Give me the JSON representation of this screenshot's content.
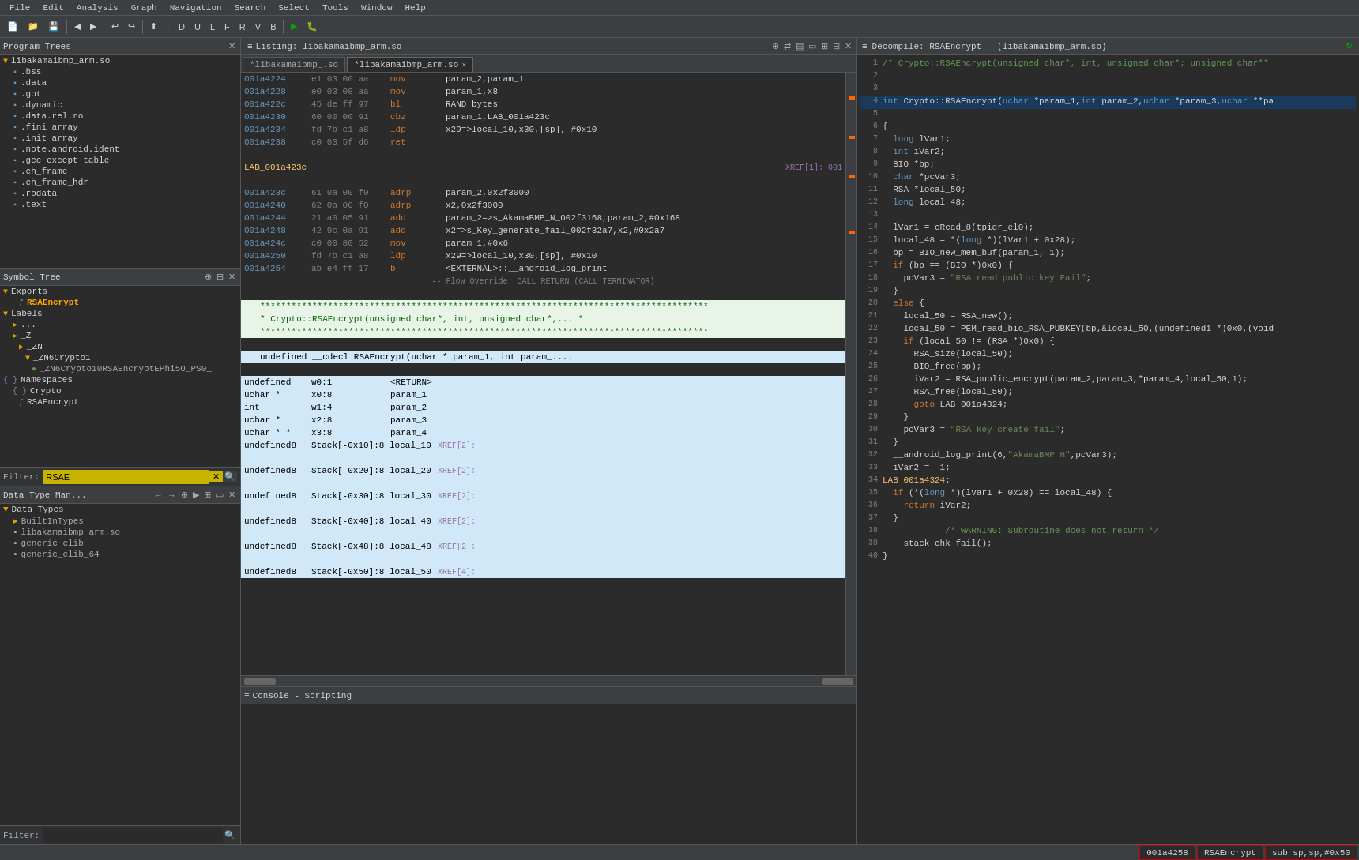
{
  "menubar": {
    "items": [
      "File",
      "Edit",
      "Analysis",
      "Graph",
      "Navigation",
      "Search",
      "Select",
      "Tools",
      "Window",
      "Help"
    ]
  },
  "left_panel": {
    "program_trees": {
      "title": "Program Trees",
      "items": [
        {
          "label": "libakamaibmp_arm.so",
          "type": "root",
          "indent": 0
        },
        {
          "label": ".bss",
          "type": "file",
          "indent": 1
        },
        {
          "label": ".data",
          "type": "file",
          "indent": 1
        },
        {
          "label": ".got",
          "type": "file",
          "indent": 1
        },
        {
          "label": ".dynamic",
          "type": "file",
          "indent": 1
        },
        {
          "label": ".data.rel.ro",
          "type": "file",
          "indent": 1
        },
        {
          "label": ".fini_array",
          "type": "file",
          "indent": 1
        },
        {
          "label": ".init_array",
          "type": "file",
          "indent": 1
        },
        {
          "label": ".note.android.ident",
          "type": "file",
          "indent": 1
        },
        {
          "label": ".gcc_except_table",
          "type": "file",
          "indent": 1
        },
        {
          "label": ".eh_frame",
          "type": "file",
          "indent": 1
        },
        {
          "label": ".eh_frame_hdr",
          "type": "file",
          "indent": 1
        },
        {
          "label": ".rodata",
          "type": "file",
          "indent": 1
        },
        {
          "label": ".text",
          "type": "file",
          "indent": 1
        },
        {
          "label": "...",
          "type": "file",
          "indent": 1
        }
      ]
    },
    "symbol_tree": {
      "title": "Symbol Tree",
      "items": [
        {
          "label": "Exports",
          "type": "folder",
          "indent": 0,
          "expanded": true
        },
        {
          "label": "RSAEncrypt",
          "type": "func",
          "indent": 2,
          "selected": true
        },
        {
          "label": "Labels",
          "type": "folder",
          "indent": 0,
          "expanded": true
        },
        {
          "label": "...",
          "type": "folder",
          "indent": 1
        },
        {
          "label": "_Z",
          "type": "folder",
          "indent": 1
        },
        {
          "label": "_ZN",
          "type": "folder",
          "indent": 2
        },
        {
          "label": "_ZN6Crypto1",
          "type": "folder",
          "indent": 3
        },
        {
          "label": "_ZN6Crypto10RSAEncryptEPhi50_PS0_",
          "type": "func",
          "indent": 4
        },
        {
          "label": "Namespaces",
          "type": "folder",
          "indent": 0
        },
        {
          "label": "Crypto",
          "type": "namespace",
          "indent": 1
        },
        {
          "label": "RSAEncrypt",
          "type": "func",
          "indent": 2
        }
      ]
    },
    "filter": {
      "label": "Filter:",
      "value": "RSAE"
    },
    "data_type_manager": {
      "title": "Data Type Man...",
      "items": [
        {
          "label": "Data Types",
          "type": "folder",
          "indent": 0
        },
        {
          "label": "BuiltInTypes",
          "type": "folder",
          "indent": 1
        },
        {
          "label": "libakamaibmp_arm.so",
          "type": "file",
          "indent": 1
        },
        {
          "label": "generic_clib",
          "type": "folder",
          "indent": 1
        },
        {
          "label": "generic_clib_64",
          "type": "folder",
          "indent": 1
        }
      ]
    },
    "filter_bottom": {
      "label": "Filter:",
      "placeholder": ""
    }
  },
  "center_panel": {
    "listing_header": {
      "title": "Listing: libakamaibmp_arm.so"
    },
    "tabs": [
      {
        "label": "*libakamaibmp_.so",
        "active": false
      },
      {
        "label": "*libakamaibmp_arm.so",
        "active": true
      }
    ],
    "code_lines": [
      {
        "addr": "001a4224",
        "bytes": "e1 03 00 aa",
        "mnemonic": "mov",
        "operands": "param_2,param_1",
        "type": "normal"
      },
      {
        "addr": "001a4228",
        "bytes": "e0 03 08 aa",
        "mnemonic": "mov",
        "operands": "param_1,x8",
        "type": "normal"
      },
      {
        "addr": "001a422c",
        "bytes": "45 de ff 97",
        "mnemonic": "bl",
        "operands": "RAND_bytes",
        "type": "normal"
      },
      {
        "addr": "001a4230",
        "bytes": "60 00 00 91",
        "mnemonic": "cbz",
        "operands": "param_1,LAB_001a423c",
        "type": "normal"
      },
      {
        "addr": "001a4234",
        "bytes": "fd 7b c1 a8",
        "mnemonic": "ldp",
        "operands": "x29=>local_10,x30,[sp], #0x10",
        "type": "normal"
      },
      {
        "addr": "001a4238",
        "bytes": "c0 03 5f d6",
        "mnemonic": "ret",
        "operands": "",
        "type": "normal"
      },
      {
        "addr": "",
        "bytes": "",
        "mnemonic": "",
        "operands": "",
        "type": "spacer"
      },
      {
        "addr": "",
        "bytes": "LAB_001a423c",
        "mnemonic": "",
        "operands": "XREF[1]:  001",
        "type": "label"
      },
      {
        "addr": "",
        "bytes": "",
        "mnemonic": "",
        "operands": "",
        "type": "spacer"
      },
      {
        "addr": "001a423c",
        "bytes": "61 0a 00 f0",
        "mnemonic": "adrp",
        "operands": "param_2,0x2f3000",
        "type": "normal"
      },
      {
        "addr": "001a4240",
        "bytes": "62 0a 00 f0",
        "mnemonic": "adrp",
        "operands": "x2,0x2f3000",
        "type": "normal"
      },
      {
        "addr": "001a4244",
        "bytes": "21 a0 05 91",
        "mnemonic": "add",
        "operands": "param_2=>s_AkamaBMP_N_002f3168,param_2,#0x168",
        "type": "normal"
      },
      {
        "addr": "001a4248",
        "bytes": "42 9c 0a 91",
        "mnemonic": "add",
        "operands": "x2=>s_Key_generate_fail_002f32a7,x2,#0x2a7",
        "type": "normal"
      },
      {
        "addr": "001a424c",
        "bytes": "c0 00 80 52",
        "mnemonic": "mov",
        "operands": "param_1,#0x6",
        "type": "normal"
      },
      {
        "addr": "001a4250",
        "bytes": "fd 7b c1 a8",
        "mnemonic": "ldp",
        "operands": "x29=>local_10,x30,[sp], #0x10",
        "type": "normal"
      },
      {
        "addr": "001a4254",
        "bytes": "ab e4 ff 17",
        "mnemonic": "b",
        "operands": "<EXTERNAL>::__android_log_print",
        "type": "normal"
      },
      {
        "addr": "",
        "bytes": "-- Flow Override: CALL_RETURN (CALL_TERMINATOR)",
        "type": "flow-override"
      },
      {
        "addr": "",
        "bytes": "",
        "type": "spacer"
      },
      {
        "addr": "",
        "bytes": "* * * * * * * * * * * * * * * * * * * *",
        "type": "comment-stars"
      },
      {
        "addr": "",
        "bytes": "* Crypto::RSAEncrypt(unsigned char*, int, unsigned char*,... *",
        "type": "comment-text"
      },
      {
        "addr": "",
        "bytes": "* * * * * * * * * * * * * * * * * * * *",
        "type": "comment-stars"
      },
      {
        "addr": "",
        "bytes": "",
        "type": "spacer"
      },
      {
        "addr": "",
        "bytes": "undefined __cdecl RSAEncrypt(uchar * param_1, int param_....",
        "type": "func-sig"
      },
      {
        "addr": "",
        "bytes": "",
        "type": "spacer"
      },
      {
        "addr": "undefined",
        "bytes": "w0:1",
        "mnemonic": "<RETURN>",
        "operands": "",
        "type": "var-def"
      },
      {
        "addr": "uchar *",
        "bytes": "x0:8",
        "mnemonic": "param_1",
        "operands": "",
        "type": "var-def"
      },
      {
        "addr": "int",
        "bytes": "w1:4",
        "mnemonic": "param_2",
        "operands": "",
        "type": "var-def"
      },
      {
        "addr": "uchar *",
        "bytes": "x2:8",
        "mnemonic": "param_3",
        "operands": "",
        "type": "var-def"
      },
      {
        "addr": "uchar * *",
        "bytes": "x3:8",
        "mnemonic": "param_4",
        "operands": "",
        "type": "var-def"
      },
      {
        "addr": "undefined8",
        "bytes": "Stack[-0x10]:8",
        "mnemonic": "local_10",
        "operands": "XREF[2]:",
        "type": "var-def"
      },
      {
        "addr": "",
        "bytes": "",
        "type": "spacer"
      },
      {
        "addr": "undefined8",
        "bytes": "Stack[-0x20]:8",
        "mnemonic": "local_20",
        "operands": "XREF[2]:",
        "type": "var-def"
      },
      {
        "addr": "",
        "bytes": "",
        "type": "spacer"
      },
      {
        "addr": "undefined8",
        "bytes": "Stack[-0x30]:8",
        "mnemonic": "local_30",
        "operands": "XREF[2]:",
        "type": "var-def"
      },
      {
        "addr": "",
        "bytes": "",
        "type": "spacer"
      },
      {
        "addr": "undefined8",
        "bytes": "Stack[-0x40]:8",
        "mnemonic": "local_40",
        "operands": "XREF[2]:",
        "type": "var-def"
      },
      {
        "addr": "",
        "bytes": "",
        "type": "spacer"
      },
      {
        "addr": "undefined8",
        "bytes": "Stack[-0x48]:8",
        "mnemonic": "local_48",
        "operands": "XREF[2]:",
        "type": "var-def"
      },
      {
        "addr": "",
        "bytes": "",
        "type": "spacer"
      },
      {
        "addr": "undefined8",
        "bytes": "Stack[-0x50]:8",
        "mnemonic": "local_50",
        "operands": "XREF[4]:",
        "type": "var-def"
      }
    ],
    "console": {
      "title": "Console - Scripting"
    }
  },
  "decompile_panel": {
    "title": "Decompile: RSAEncrypt - (libakamaibmp_arm.so)",
    "lines": [
      {
        "no": "1",
        "code": "/* Crypto::RSAEncrypt(unsigned char*, int, unsigned char*; unsigned char**",
        "type": "comment"
      },
      {
        "no": "2",
        "code": "",
        "type": "normal"
      },
      {
        "no": "3",
        "code": "",
        "type": "normal"
      },
      {
        "no": "4",
        "code": "int Crypto::RSAEncrypt(uchar *param_1,int param_2,uchar *param_3,uchar **pa",
        "type": "highlighted"
      },
      {
        "no": "5",
        "code": "",
        "type": "normal"
      },
      {
        "no": "6",
        "code": "{",
        "type": "normal"
      },
      {
        "no": "7",
        "code": "  long lVar1;",
        "type": "normal"
      },
      {
        "no": "8",
        "code": "  int iVar2;",
        "type": "normal"
      },
      {
        "no": "9",
        "code": "  BIO *bp;",
        "type": "normal"
      },
      {
        "no": "10",
        "code": "  char *pcVar3;",
        "type": "normal"
      },
      {
        "no": "11",
        "code": "  RSA *local_50;",
        "type": "normal"
      },
      {
        "no": "12",
        "code": "  long local_48;",
        "type": "normal"
      },
      {
        "no": "13",
        "code": "",
        "type": "normal"
      },
      {
        "no": "14",
        "code": "  lVar1 = cRead_8(tpidr_el0);",
        "type": "normal"
      },
      {
        "no": "15",
        "code": "  local_48 = *(long *)(lVar1 + 0x28);",
        "type": "normal"
      },
      {
        "no": "16",
        "code": "  bp = BIO_new_mem_buf(param_1,-1);",
        "type": "normal"
      },
      {
        "no": "17",
        "code": "  if (bp == (BIO *)0x0) {",
        "type": "normal"
      },
      {
        "no": "18",
        "code": "    pcVar3 = \"RSA read public key Fail\";",
        "type": "normal"
      },
      {
        "no": "19",
        "code": "  }",
        "type": "normal"
      },
      {
        "no": "20",
        "code": "  else {",
        "type": "normal"
      },
      {
        "no": "21",
        "code": "    local_50 = RSA_new();",
        "type": "normal"
      },
      {
        "no": "22",
        "code": "    local_50 = PEM_read_bio_RSA_PUBKEY(bp,&local_50,(undefined1 *)0x0,(void",
        "type": "normal"
      },
      {
        "no": "23",
        "code": "    if (local_50 != (RSA *)0x0) {",
        "type": "normal"
      },
      {
        "no": "24",
        "code": "      RSA_size(local_50);",
        "type": "normal"
      },
      {
        "no": "25",
        "code": "      BIO_free(bp);",
        "type": "normal"
      },
      {
        "no": "26",
        "code": "      iVar2 = RSA_public_encrypt(param_2,param_3,*param_4,local_50,1);",
        "type": "normal"
      },
      {
        "no": "27",
        "code": "      RSA_free(local_50);",
        "type": "normal"
      },
      {
        "no": "28",
        "code": "      goto LAB_001a4324;",
        "type": "normal"
      },
      {
        "no": "29",
        "code": "    }",
        "type": "normal"
      },
      {
        "no": "30",
        "code": "    pcVar3 = \"RSA key create fail\";",
        "type": "normal"
      },
      {
        "no": "31",
        "code": "  }",
        "type": "normal"
      },
      {
        "no": "32",
        "code": "  __android_log_print(6,\"AkamaBMP N\",pcVar3);",
        "type": "normal"
      },
      {
        "no": "33",
        "code": "  iVar2 = -1;",
        "type": "normal"
      },
      {
        "no": "34",
        "code": "LAB_001a4324:",
        "type": "label-line"
      },
      {
        "no": "35",
        "code": "  if (*(long *)(lVar1 + 0x28) == local_48) {",
        "type": "normal"
      },
      {
        "no": "36",
        "code": "    return iVar2;",
        "type": "normal"
      },
      {
        "no": "37",
        "code": "  }",
        "type": "normal"
      },
      {
        "no": "38",
        "code": "            /* WARNING: Subroutine does not return */",
        "type": "comment"
      },
      {
        "no": "39",
        "code": "  __stack_chk_fail();",
        "type": "normal"
      },
      {
        "no": "40",
        "code": "}",
        "type": "normal"
      }
    ]
  },
  "status_bar": {
    "address": "001a4258",
    "function": "RSAEncrypt",
    "instruction": "sub sp,sp,#0x50"
  }
}
